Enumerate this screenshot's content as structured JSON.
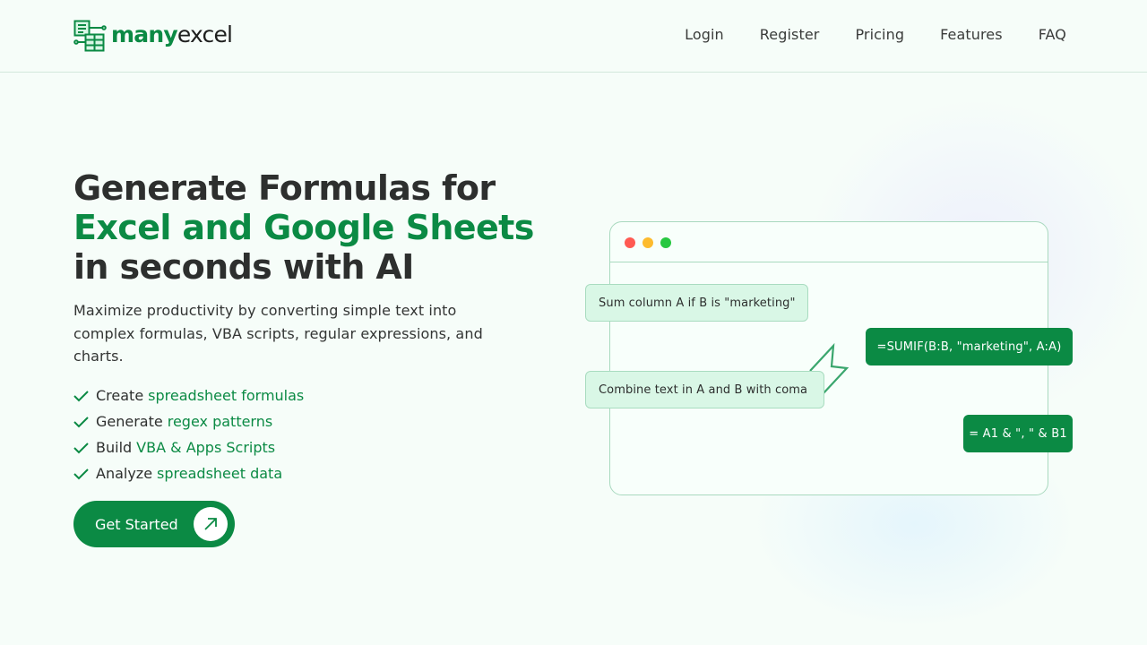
{
  "brand": {
    "name_part_1": "many",
    "name_part_2": "excel",
    "logo_icon": "spreadsheet-doc-icon",
    "accent_color": "#0b8a44"
  },
  "nav": {
    "items": [
      {
        "label": "Login"
      },
      {
        "label": "Register"
      },
      {
        "label": "Pricing"
      },
      {
        "label": "Features"
      },
      {
        "label": "FAQ"
      }
    ]
  },
  "hero": {
    "title_line_1": "Generate Formulas for",
    "title_line_2": "Excel and Google Sheets",
    "title_line_3": "in seconds with AI",
    "description": "Maximize productivity by converting simple text into complex formulas, VBA scripts, regular expressions, and charts.",
    "features": [
      {
        "icon": "check-icon",
        "prefix": "Create",
        "highlight": "spreadsheet formulas"
      },
      {
        "icon": "check-icon",
        "prefix": "Generate",
        "highlight": "regex patterns"
      },
      {
        "icon": "check-icon",
        "prefix": "Build",
        "highlight": "VBA & Apps Scripts"
      },
      {
        "icon": "check-icon",
        "prefix": "Analyze",
        "highlight": "spreadsheet data"
      }
    ],
    "cta_label": "Get Started",
    "cta_icon": "arrow-up-right-icon"
  },
  "demo_window": {
    "window_controls": [
      "close",
      "minimize",
      "maximize"
    ],
    "prompts": [
      {
        "text": "Sum column A if B is \"marketing\""
      },
      {
        "text": "Combine text in A and B with coma"
      }
    ],
    "formulas": [
      {
        "text": "=SUMIF(B:B, \"marketing\", A:A)"
      },
      {
        "text": "= A1 & \", \" & B1"
      }
    ]
  }
}
